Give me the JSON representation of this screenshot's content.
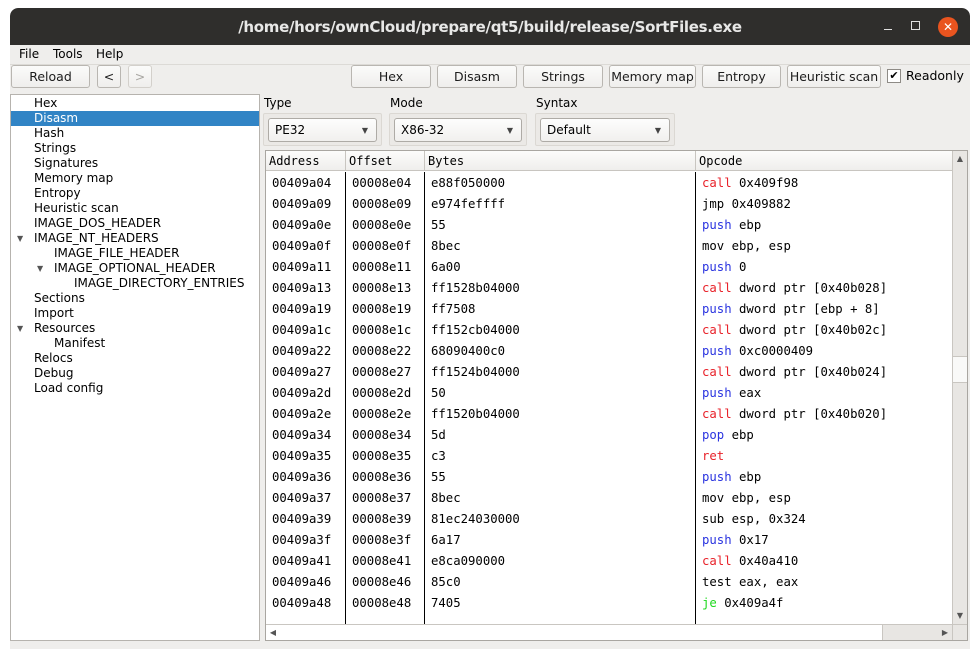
{
  "window": {
    "title": "/home/hors/ownCloud/prepare/qt5/build/release/SortFiles.exe",
    "controls": {
      "minimize": "minimize",
      "maximize": "maximize",
      "close": "✕"
    }
  },
  "menubar": {
    "items": [
      "File",
      "Tools",
      "Help"
    ]
  },
  "toolbar": {
    "reload": "Reload",
    "back": "<",
    "forward": ">",
    "views": [
      "Hex",
      "Disasm",
      "Strings",
      "Memory map",
      "Entropy",
      "Heuristic scan"
    ],
    "readonly_label": "Readonly",
    "readonly_checked": true,
    "check_glyph": "✔"
  },
  "tree": {
    "selected": "Disasm",
    "items": [
      {
        "label": "Hex",
        "level": 0,
        "expanded": null
      },
      {
        "label": "Disasm",
        "level": 0,
        "expanded": null
      },
      {
        "label": "Hash",
        "level": 0,
        "expanded": null
      },
      {
        "label": "Strings",
        "level": 0,
        "expanded": null
      },
      {
        "label": "Signatures",
        "level": 0,
        "expanded": null
      },
      {
        "label": "Memory map",
        "level": 0,
        "expanded": null
      },
      {
        "label": "Entropy",
        "level": 0,
        "expanded": null
      },
      {
        "label": "Heuristic scan",
        "level": 0,
        "expanded": null
      },
      {
        "label": "IMAGE_DOS_HEADER",
        "level": 0,
        "expanded": null
      },
      {
        "label": "IMAGE_NT_HEADERS",
        "level": 0,
        "expanded": true
      },
      {
        "label": "IMAGE_FILE_HEADER",
        "level": 1,
        "expanded": null
      },
      {
        "label": "IMAGE_OPTIONAL_HEADER",
        "level": 1,
        "expanded": true
      },
      {
        "label": "IMAGE_DIRECTORY_ENTRIES",
        "level": 2,
        "expanded": null
      },
      {
        "label": "Sections",
        "level": 0,
        "expanded": null
      },
      {
        "label": "Import",
        "level": 0,
        "expanded": null
      },
      {
        "label": "Resources",
        "level": 0,
        "expanded": true
      },
      {
        "label": "Manifest",
        "level": 1,
        "expanded": null
      },
      {
        "label": "Relocs",
        "level": 0,
        "expanded": null
      },
      {
        "label": "Debug",
        "level": 0,
        "expanded": null
      },
      {
        "label": "Load config",
        "level": 0,
        "expanded": null
      }
    ]
  },
  "filters": {
    "type": {
      "label": "Type",
      "value": "PE32"
    },
    "mode": {
      "label": "Mode",
      "value": "X86-32"
    },
    "syntax": {
      "label": "Syntax",
      "value": "Default"
    }
  },
  "disasm": {
    "columns": [
      "Address",
      "Offset",
      "Bytes",
      "Opcode"
    ],
    "mnemonic_colors": {
      "call": "#e8222a",
      "ret": "#e8222a",
      "push": "#2a34e0",
      "pop": "#2a34e0",
      "je": "#1ed81e"
    },
    "rows": [
      {
        "address": "00409a04",
        "offset": "00008e04",
        "bytes": "e88f050000",
        "mnemonic": "call",
        "operands": "0x409f98"
      },
      {
        "address": "00409a09",
        "offset": "00008e09",
        "bytes": "e974feffff",
        "mnemonic": "jmp",
        "operands": "0x409882"
      },
      {
        "address": "00409a0e",
        "offset": "00008e0e",
        "bytes": "55",
        "mnemonic": "push",
        "operands": "ebp"
      },
      {
        "address": "00409a0f",
        "offset": "00008e0f",
        "bytes": "8bec",
        "mnemonic": "mov",
        "operands": "ebp, esp"
      },
      {
        "address": "00409a11",
        "offset": "00008e11",
        "bytes": "6a00",
        "mnemonic": "push",
        "operands": "0"
      },
      {
        "address": "00409a13",
        "offset": "00008e13",
        "bytes": "ff1528b04000",
        "mnemonic": "call",
        "operands": "dword ptr [0x40b028]"
      },
      {
        "address": "00409a19",
        "offset": "00008e19",
        "bytes": "ff7508",
        "mnemonic": "push",
        "operands": "dword ptr [ebp + 8]"
      },
      {
        "address": "00409a1c",
        "offset": "00008e1c",
        "bytes": "ff152cb04000",
        "mnemonic": "call",
        "operands": "dword ptr [0x40b02c]"
      },
      {
        "address": "00409a22",
        "offset": "00008e22",
        "bytes": "68090400c0",
        "mnemonic": "push",
        "operands": "0xc0000409"
      },
      {
        "address": "00409a27",
        "offset": "00008e27",
        "bytes": "ff1524b04000",
        "mnemonic": "call",
        "operands": "dword ptr [0x40b024]"
      },
      {
        "address": "00409a2d",
        "offset": "00008e2d",
        "bytes": "50",
        "mnemonic": "push",
        "operands": "eax"
      },
      {
        "address": "00409a2e",
        "offset": "00008e2e",
        "bytes": "ff1520b04000",
        "mnemonic": "call",
        "operands": "dword ptr [0x40b020]"
      },
      {
        "address": "00409a34",
        "offset": "00008e34",
        "bytes": "5d",
        "mnemonic": "pop",
        "operands": "ebp"
      },
      {
        "address": "00409a35",
        "offset": "00008e35",
        "bytes": "c3",
        "mnemonic": "ret",
        "operands": ""
      },
      {
        "address": "00409a36",
        "offset": "00008e36",
        "bytes": "55",
        "mnemonic": "push",
        "operands": "ebp"
      },
      {
        "address": "00409a37",
        "offset": "00008e37",
        "bytes": "8bec",
        "mnemonic": "mov",
        "operands": "ebp, esp"
      },
      {
        "address": "00409a39",
        "offset": "00008e39",
        "bytes": "81ec24030000",
        "mnemonic": "sub",
        "operands": "esp, 0x324"
      },
      {
        "address": "00409a3f",
        "offset": "00008e3f",
        "bytes": "6a17",
        "mnemonic": "push",
        "operands": "0x17"
      },
      {
        "address": "00409a41",
        "offset": "00008e41",
        "bytes": "e8ca090000",
        "mnemonic": "call",
        "operands": "0x40a410"
      },
      {
        "address": "00409a46",
        "offset": "00008e46",
        "bytes": "85c0",
        "mnemonic": "test",
        "operands": "eax, eax"
      },
      {
        "address": "00409a48",
        "offset": "00008e48",
        "bytes": "7405",
        "mnemonic": "je",
        "operands": "0x409a4f"
      }
    ]
  }
}
